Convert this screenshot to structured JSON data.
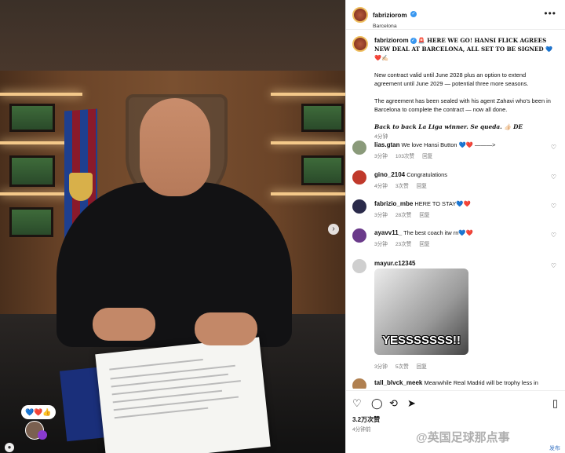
{
  "photo": {
    "reaction_bubble": "💙❤️👍",
    "next_icon": "chevron-right-icon"
  },
  "post": {
    "username": "fabriziorom",
    "location": "Barcelona",
    "more_icon": "•••"
  },
  "caption": {
    "username": "fabriziorom",
    "title": "🚨 HERE WE GO! HANSI FLICK AGREES NEW DEAL AT BARCELONA, ALL SET TO BE SIGNED 💙❤️✍🏻",
    "p1": "New contract valid until June 2028 plus an option to extend agreement until June 2029 — potential three more seasons.",
    "p2": "The agreement has been sealed with his agent Zahavi who's been in Barcelona to complete the contract — now all done.",
    "p3": "Back to back La Liga winner. Se queda. 👍🏻 DE",
    "time": "4分钟"
  },
  "comments": [
    {
      "user": "lias.gtan",
      "text": "We love Hansi Button 💙❤️ ———>",
      "time": "3分钟",
      "likes": "103次赞",
      "reply": "回复",
      "color": "#8a9a7a"
    },
    {
      "user": "gino_2104",
      "text": "Congratulations",
      "time": "4分钟",
      "likes": "3次赞",
      "reply": "回复",
      "color": "#c0392b"
    },
    {
      "user": "fabrizio_mbe",
      "text": "HERE TO STAY💙❤️",
      "time": "3分钟",
      "likes": "28次赞",
      "reply": "回复",
      "color": "#2a2a4a"
    },
    {
      "user": "ayavv11_",
      "text": "The best coach itw rn💙❤️",
      "time": "3分钟",
      "likes": "23次赞",
      "reply": "回复",
      "color": "#6a3a8a"
    },
    {
      "user": "mayur.c12345",
      "text": "",
      "time": "3分钟",
      "likes": "5次赞",
      "reply": "回复",
      "color": "#cfcfcf",
      "gif_text": "YESSSSSSS!!"
    },
    {
      "user": "tall_blvck_meek",
      "text": "Meanwhile Real Madrid will be trophy less in",
      "color": "#b08050"
    }
  ],
  "actions": {
    "likes": "3.2万次赞",
    "time": "4分钟前"
  },
  "watermark": {
    "text": "@英国足球那点事",
    "sub": "发布"
  }
}
